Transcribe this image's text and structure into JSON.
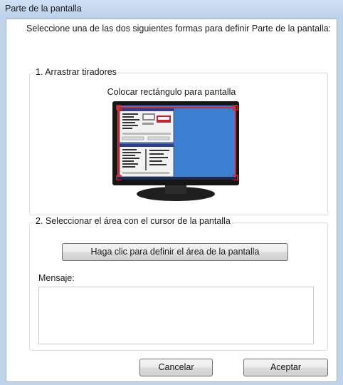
{
  "window": {
    "title": "Parte de la pantalla"
  },
  "intro": "Seleccione una de las dos siguientes formas para definir Parte de la pantalla:",
  "group_drag": {
    "title": "1. Arrastrar tiradores",
    "caption": "Colocar rectángulo para pantalla"
  },
  "group_select": {
    "title": "2. Seleccionar el área con el cursor de la pantalla",
    "define_button": "Haga clic para definir el área de la pantalla",
    "message_label": "Mensaje:",
    "message_value": ""
  },
  "buttons": {
    "cancel": "Cancelar",
    "ok": "Aceptar"
  },
  "colors": {
    "screen_blue": "#3a7fd0",
    "handle_red": "#e0202a",
    "window_frame": "#bfd3ea"
  }
}
